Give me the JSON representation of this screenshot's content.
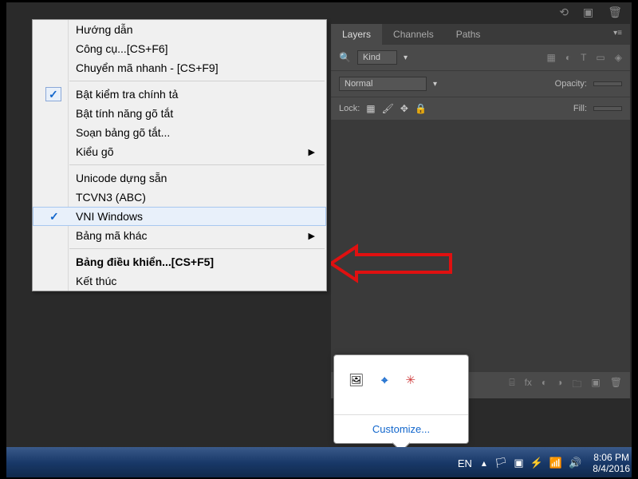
{
  "top_icons": [
    "cycle",
    "layers",
    "trash"
  ],
  "panel": {
    "tabs": [
      {
        "label": "Layers",
        "active": true
      },
      {
        "label": "Channels",
        "active": false
      },
      {
        "label": "Paths",
        "active": false
      }
    ],
    "kind_label": "Kind",
    "blend_mode": "Normal",
    "opacity_label": "Opacity:",
    "lock_label": "Lock:",
    "fill_label": "Fill:"
  },
  "menu": {
    "items": [
      {
        "label": "Hướng dẫn"
      },
      {
        "label": "Công cụ...[CS+F6]"
      },
      {
        "label": "Chuyển mã nhanh - [CS+F9]"
      },
      {
        "separator": true
      },
      {
        "label": "Bật kiểm tra chính tả",
        "checked": true,
        "checkbox": true
      },
      {
        "label": "Bật tính năng gõ tắt"
      },
      {
        "label": "Soạn bảng gõ tắt..."
      },
      {
        "label": "Kiểu gõ",
        "submenu": true
      },
      {
        "separator": true
      },
      {
        "label": "Unicode dựng sẵn"
      },
      {
        "label": "TCVN3 (ABC)"
      },
      {
        "label": "VNI Windows",
        "checked": true,
        "highlighted": true
      },
      {
        "label": "Bảng mã khác",
        "submenu": true
      },
      {
        "separator": true
      },
      {
        "label": "Bảng điều khiển...[CS+F5]",
        "bold": true
      },
      {
        "label": "Kết thúc"
      }
    ]
  },
  "tray": {
    "icons": [
      "image",
      "bluetooth",
      "sparkle"
    ],
    "customize": "Customize..."
  },
  "taskbar": {
    "lang": "EN",
    "sys_icons": [
      "flag",
      "shield",
      "power",
      "wifi",
      "volume"
    ],
    "time": "8:06 PM",
    "date": "8/4/2016"
  }
}
